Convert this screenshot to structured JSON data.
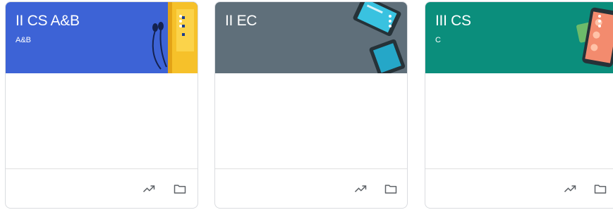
{
  "classes": [
    {
      "title": "II CS A&B",
      "section": "A&B",
      "color": "#3d63d6",
      "illustration": "headphones-notebook"
    },
    {
      "title": "II EC",
      "section": "",
      "color": "#5f6f7a",
      "illustration": "tablets"
    },
    {
      "title": "III CS",
      "section": "C",
      "color": "#0b8e7c",
      "illustration": "phone"
    }
  ],
  "icons": {
    "options": "more-vert-icon",
    "trend": "trending-up-icon",
    "folder": "folder-icon"
  }
}
